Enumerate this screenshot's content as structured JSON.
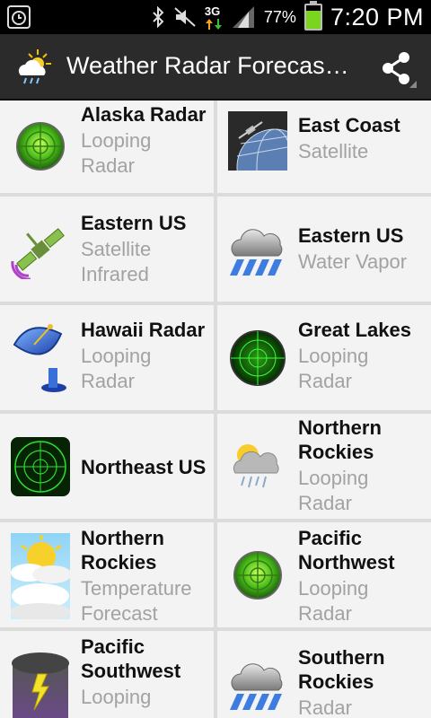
{
  "status_bar": {
    "battery_percent": "77%",
    "battery_level": 0.77,
    "time": "7:20 PM",
    "network": "3G",
    "icons": [
      "alarm-icon",
      "bluetooth-icon",
      "mute-icon",
      "signal-icon",
      "battery-icon"
    ]
  },
  "app_bar": {
    "title": "Weather Radar Forecas…",
    "icons": [
      "weather-app-icon",
      "share-icon"
    ]
  },
  "items": [
    {
      "title": "Alaska Radar",
      "subtitle": "Looping Radar",
      "icon": "green-radar-icon"
    },
    {
      "title": "East Coast",
      "subtitle": "Satellite",
      "icon": "satellite-earth-icon"
    },
    {
      "title": "Eastern US",
      "subtitle": "Satellite Infrared",
      "icon": "infrared-satellite-icon"
    },
    {
      "title": "Eastern US",
      "subtitle": "Water Vapor",
      "icon": "rain-cloud-icon"
    },
    {
      "title": "Hawaii Radar",
      "subtitle": "Looping Radar",
      "icon": "satellite-dish-icon"
    },
    {
      "title": "Great Lakes",
      "subtitle": "Looping Radar",
      "icon": "green-radar-icon"
    },
    {
      "title": "Northeast US",
      "subtitle": "",
      "icon": "square-radar-icon"
    },
    {
      "title": "Northern Rockies",
      "subtitle": "Looping Radar",
      "icon": "sun-rain-cloud-icon"
    },
    {
      "title": "Northern Rockies",
      "subtitle": "Temperature Forecast",
      "icon": "sunny-clouds-icon"
    },
    {
      "title": "Pacific Northwest",
      "subtitle": "Looping Radar",
      "icon": "green-radar-icon"
    },
    {
      "title": "Pacific Southwest",
      "subtitle": "Looping",
      "icon": "lightning-storm-icon"
    },
    {
      "title": "Southern Rockies",
      "subtitle": "Radar",
      "icon": "rain-cloud-icon"
    }
  ]
}
